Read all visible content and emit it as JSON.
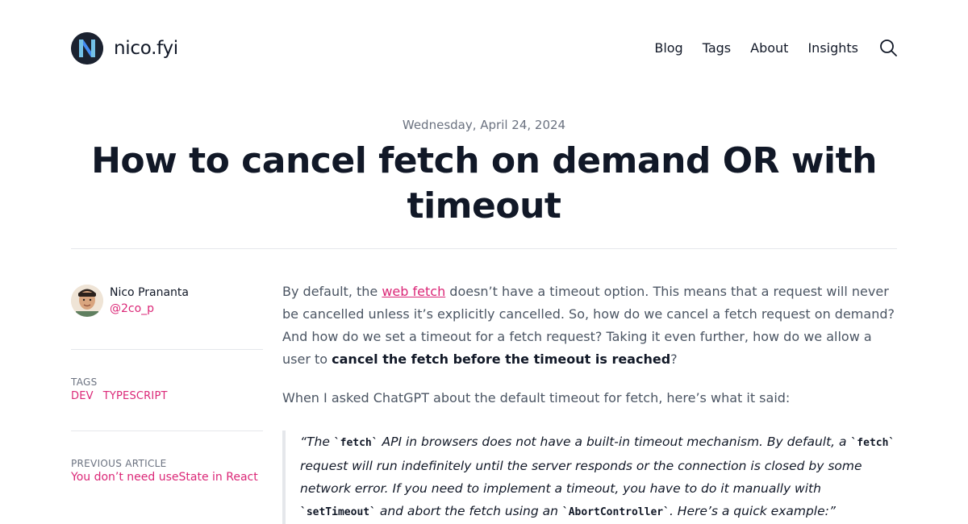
{
  "header": {
    "site_name": "nico.fyi",
    "logo_letter": "N",
    "nav": [
      {
        "label": "Blog"
      },
      {
        "label": "Tags"
      },
      {
        "label": "About"
      },
      {
        "label": "Insights"
      }
    ],
    "search_icon": "search-icon"
  },
  "article": {
    "date": "Wednesday, April 24, 2024",
    "title": "How to cancel fetch on demand OR with timeout"
  },
  "author": {
    "name": "Nico Prananta",
    "handle": "@2co_p"
  },
  "sidebar": {
    "tags_label": "TAGS",
    "tags": [
      "DEV",
      "TYPESCRIPT"
    ],
    "previous_label": "PREVIOUS ARTICLE",
    "previous_title": "You don’t need useState in React"
  },
  "content": {
    "p1_before": "By default, the ",
    "p1_link": "web fetch",
    "p1_after": " doesn’t have a timeout option. This means that a request will never be cancelled unless it’s explicitly cancelled. So, how do we cancel a fetch request on demand? And how do we set a timeout for a fetch request? Taking it even further, how do we allow a user to ",
    "p1_bold": "cancel the fetch before the timeout is reached",
    "p1_end": "?",
    "p2": "When I asked ChatGPT about the default timeout for fetch, here’s what it said:",
    "quote": {
      "t1": "“The ",
      "c1": "`fetch`",
      "t2": " API in browsers does not have a built-in timeout mechanism. By default, a ",
      "c2": "`fetch`",
      "t3": " request will run indefinitely until the server responds or the connection is closed by some network error. If you need to implement a timeout, you have to do it manually with ",
      "c3": "`setTimeout`",
      "t4": " and abort the fetch using an ",
      "c4": "`AbortController`",
      "t5": ". Here’s a quick example:”"
    }
  },
  "colors": {
    "accent": "#db2777",
    "text": "#111827",
    "muted": "#6b7280",
    "body": "#4b5563",
    "rule": "#e5e7eb"
  }
}
